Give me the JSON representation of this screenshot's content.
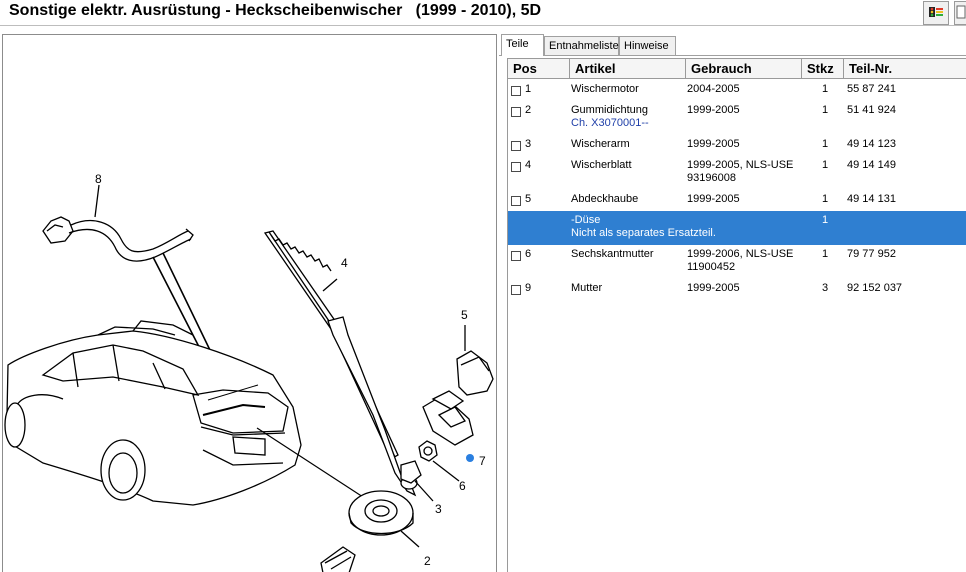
{
  "header": {
    "title": "Sonstige elektr. Ausrüstung - Heckscheibenwischer   (1999 - 2010), 5D",
    "toolbar_icon": "traffic-light-icon",
    "toolbar_icon2": "document-icon"
  },
  "diagram": {
    "callouts": [
      "8",
      "4",
      "5",
      "7",
      "6",
      "3",
      "2"
    ]
  },
  "tabs": [
    {
      "label": "Teile",
      "active": true
    },
    {
      "label": "Entnahmeliste",
      "active": false
    },
    {
      "label": "Hinweise",
      "active": false
    }
  ],
  "table": {
    "columns": [
      "Pos",
      "Artikel",
      "Gebrauch",
      "Stkz",
      "Teil-Nr."
    ],
    "rows": [
      {
        "pos": "1",
        "artikel": "Wischermotor",
        "artikel2": "",
        "gebrauch": "2004-2005",
        "gebrauch2": "",
        "stkz": "1",
        "teil": "55 87 241",
        "checkbox": true
      },
      {
        "pos": "2",
        "artikel": "Gummidichtung",
        "artikel2": "Ch. X3070001--",
        "gebrauch": "1999-2005",
        "gebrauch2": "",
        "stkz": "1",
        "teil": "51 41 924",
        "checkbox": true
      },
      {
        "pos": "3",
        "artikel": "Wischerarm",
        "artikel2": "",
        "gebrauch": "1999-2005",
        "gebrauch2": "",
        "stkz": "1",
        "teil": "49 14 123",
        "checkbox": true
      },
      {
        "pos": "4",
        "artikel": "Wischerblatt",
        "artikel2": "",
        "gebrauch": "1999-2005, NLS-USE",
        "gebrauch2": "93196008",
        "stkz": "1",
        "teil": "49 14 149",
        "checkbox": true
      },
      {
        "pos": "5",
        "artikel": "Abdeckhaube",
        "artikel2": "",
        "gebrauch": "1999-2005",
        "gebrauch2": "",
        "stkz": "1",
        "teil": "49 14 131",
        "checkbox": true
      },
      {
        "pos": "",
        "artikel": "-Düse",
        "artikel2": "Nicht als separates Ersatzteil.",
        "gebrauch": "",
        "gebrauch2": "",
        "stkz": "1",
        "teil": "",
        "checkbox": false,
        "selected": true
      },
      {
        "pos": "6",
        "artikel": "Sechskantmutter",
        "artikel2": "",
        "gebrauch": "1999-2006, NLS-USE",
        "gebrauch2": "11900452",
        "stkz": "1",
        "teil": "79 77 952",
        "checkbox": true
      },
      {
        "pos": "9",
        "artikel": "Mutter",
        "artikel2": "",
        "gebrauch": "1999-2005",
        "gebrauch2": "",
        "stkz": "3",
        "teil": "92 152 037",
        "checkbox": true
      }
    ]
  },
  "colors": {
    "selection": "#2f7fd1",
    "callout_dot": "#2a7fe0",
    "subtext": "#1f3fa8"
  }
}
